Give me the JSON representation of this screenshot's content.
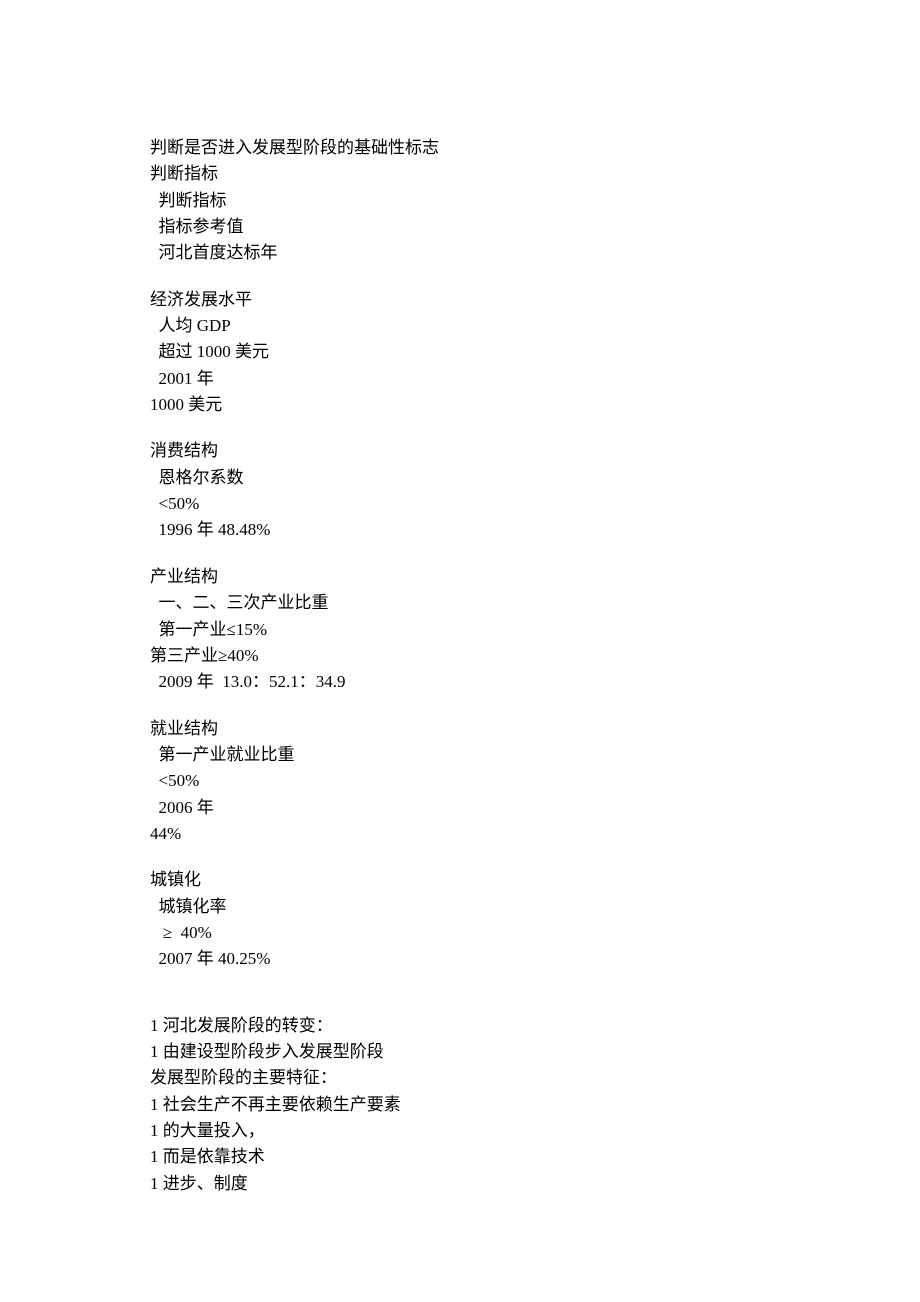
{
  "title": "判断是否进入发展型阶段的基础性标志",
  "header": {
    "label1": "判断指标",
    "label2": "  判断指标",
    "label3": "  指标参考值",
    "label4": "  河北首度达标年"
  },
  "sections": [
    {
      "category": "经济发展水平",
      "indicator": "  人均 GDP",
      "reference": "  超过 1000 美元",
      "year": "  2001 年",
      "extra": "1000 美元"
    },
    {
      "category": "消费结构",
      "indicator": "  恩格尔系数",
      "reference": "  <50%",
      "year": "  1996 年 48.48%"
    },
    {
      "category": "产业结构",
      "indicator": "  一、二、三次产业比重",
      "reference": "  第一产业≤15%",
      "reference2": "第三产业≥40%",
      "year": "  2009 年  13.0：52.1：34.9"
    },
    {
      "category": "就业结构",
      "indicator": "  第一产业就业比重",
      "reference": "  <50%",
      "year": "  2006 年",
      "extra": "44%"
    },
    {
      "category": "城镇化",
      "indicator": "  城镇化率",
      "reference": "   ≥  40%",
      "year": "  2007 年 40.25%"
    }
  ],
  "notes": [
    "1 河北发展阶段的转变：",
    "1 由建设型阶段步入发展型阶段",
    "发展型阶段的主要特征：",
    "1 社会生产不再主要依赖生产要素",
    "1 的大量投入，",
    "1 而是依靠技术",
    "1 进步、制度"
  ]
}
